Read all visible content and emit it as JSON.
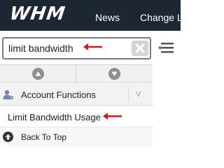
{
  "header": {
    "logo_text": "WHM",
    "nav_items": [
      "News",
      "Change L"
    ]
  },
  "search": {
    "value": "limit bandwidth",
    "clear_icon": "x-icon"
  },
  "sidebar": {
    "collapse_up_icon": "chevron-up-icon",
    "collapse_down_icon": "chevron-down-icon",
    "category": {
      "label": "Account Functions",
      "icon": "user-gear-icon"
    },
    "result": {
      "label": "Limit Bandwidth Usage"
    },
    "back_to_top": {
      "label": "Back To Top",
      "icon": "arrow-up-circle-icon"
    }
  },
  "colors": {
    "topbar": "#1f2733",
    "annotation_arrow": "#d11a1a"
  }
}
